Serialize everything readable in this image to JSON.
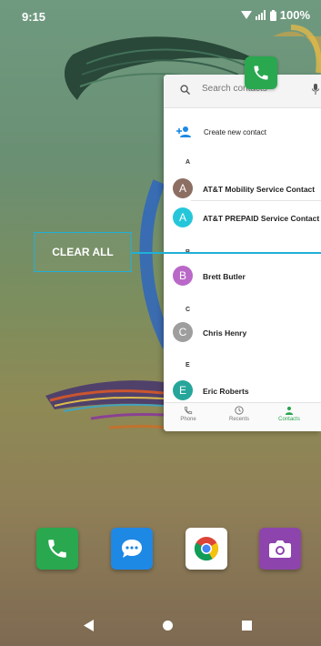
{
  "status_bar": {
    "time": "9:15",
    "battery": "100%"
  },
  "recent_app": {
    "search_placeholder": "Search contacts",
    "create_contact_label": "Create new contact",
    "sections": [
      {
        "letter": "A",
        "contacts": [
          {
            "initial": "A",
            "name": "AT&T Mobility Service Contact",
            "color": "#8d6e63"
          },
          {
            "initial": "A",
            "name": "AT&T PREPAID Service Contact",
            "color": "#26c6da"
          }
        ]
      },
      {
        "letter": "B",
        "contacts": [
          {
            "initial": "B",
            "name": "Brett Butler",
            "color": "#ba68c8"
          }
        ]
      },
      {
        "letter": "C",
        "contacts": [
          {
            "initial": "C",
            "name": "Chris Henry",
            "color": "#9e9e9e"
          }
        ]
      },
      {
        "letter": "E",
        "contacts": [
          {
            "initial": "E",
            "name": "Eric Roberts",
            "color": "#26a69a"
          }
        ]
      }
    ],
    "tabs": [
      {
        "label": "Phone",
        "icon": "phone-icon",
        "active": false
      },
      {
        "label": "Recents",
        "icon": "clock-icon",
        "active": false
      },
      {
        "label": "Contacts",
        "icon": "person-icon",
        "active": true
      }
    ]
  },
  "clear_all_label": "CLEAR ALL",
  "dock": [
    {
      "name": "phone-app",
      "icon": "phone-icon",
      "color": "#29a84f"
    },
    {
      "name": "messages-app",
      "icon": "chat-bubble-icon",
      "color": "#1e88e5"
    },
    {
      "name": "chrome-app",
      "icon": "chrome-icon",
      "color": "#ffffff"
    },
    {
      "name": "camera-app",
      "icon": "camera-icon",
      "color": "#8e44ad"
    }
  ],
  "colors": {
    "accent": "#1fb0d8",
    "active_tab": "#2aa44f"
  }
}
